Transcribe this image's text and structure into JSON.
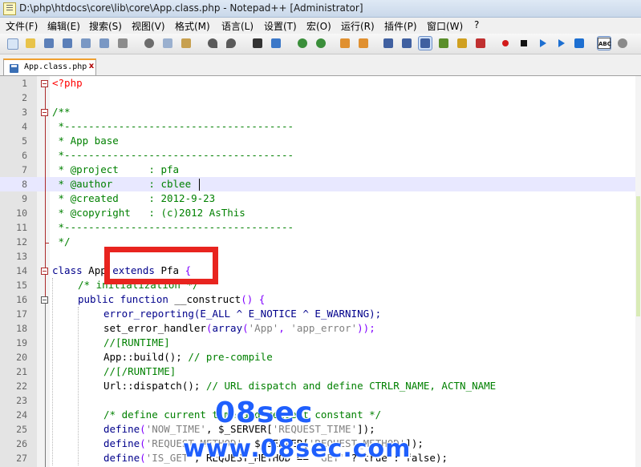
{
  "window": {
    "title": "D:\\php\\htdocs\\core\\lib\\core\\App.class.php - Notepad++ [Administrator]"
  },
  "menu": {
    "items": [
      {
        "label": "文件(F)"
      },
      {
        "label": "编辑(E)"
      },
      {
        "label": "搜索(S)"
      },
      {
        "label": "视图(V)"
      },
      {
        "label": "格式(M)"
      },
      {
        "label": "语言(L)"
      },
      {
        "label": "设置(T)"
      },
      {
        "label": "宏(O)"
      },
      {
        "label": "运行(R)"
      },
      {
        "label": "插件(P)"
      },
      {
        "label": "窗口(W)"
      },
      {
        "label": "?"
      }
    ]
  },
  "toolbar": {
    "buttons": [
      {
        "icon": "new-file-icon",
        "color": "#d8e6f6"
      },
      {
        "icon": "open-file-icon",
        "color": "#e8c34a"
      },
      {
        "icon": "save-icon",
        "color": "#5b7fb8"
      },
      {
        "icon": "save-all-icon",
        "color": "#5b7fb8"
      },
      {
        "icon": "close-icon",
        "color": "#7a98c4"
      },
      {
        "icon": "close-all-icon",
        "color": "#7a98c4"
      },
      {
        "icon": "print-icon",
        "color": "#8c8c8c"
      },
      {
        "icon": "cut-icon",
        "color": "#6c6c6c"
      },
      {
        "icon": "copy-icon",
        "color": "#9ab0cf"
      },
      {
        "icon": "paste-icon",
        "color": "#c7a04f"
      },
      {
        "icon": "undo-icon",
        "color": "#5a5a5a"
      },
      {
        "icon": "redo-icon",
        "color": "#5a5a5a"
      },
      {
        "icon": "find-icon",
        "color": "#333333"
      },
      {
        "icon": "replace-icon",
        "color": "#3c78c8"
      },
      {
        "icon": "zoom-in-icon",
        "color": "#3a8e3a"
      },
      {
        "icon": "zoom-out-icon",
        "color": "#3a8e3a"
      },
      {
        "icon": "sync-vertical-icon",
        "color": "#e09030"
      },
      {
        "icon": "sync-horizontal-icon",
        "color": "#e09030"
      },
      {
        "icon": "word-wrap-icon",
        "color": "#4060a0"
      },
      {
        "icon": "show-all-chars-icon",
        "color": "#4060a0"
      },
      {
        "icon": "indent-guide-icon",
        "color": "#4060a0"
      },
      {
        "icon": "udl-icon",
        "color": "#5a8e2a"
      },
      {
        "icon": "doc-map-icon",
        "color": "#d0a020"
      },
      {
        "icon": "function-list-icon",
        "color": "#c03030"
      },
      {
        "icon": "record-macro-icon",
        "color": "#d21a1a"
      },
      {
        "icon": "stop-record-icon",
        "color": "#111111"
      },
      {
        "icon": "play-macro-icon",
        "color": "#1d6fd1"
      },
      {
        "icon": "play-multiple-icon",
        "color": "#1d6fd1"
      },
      {
        "icon": "save-macro-icon",
        "color": "#1d6fd1"
      },
      {
        "icon": "spell-check-icon",
        "color": "#ffffff"
      },
      {
        "icon": "plugin-icon",
        "color": "#8a8a8a"
      }
    ]
  },
  "tab": {
    "label": "App.class.php",
    "close": "x"
  },
  "editor": {
    "lines": [
      {
        "n": "1"
      },
      {
        "n": "2"
      },
      {
        "n": "3"
      },
      {
        "n": "4"
      },
      {
        "n": "5"
      },
      {
        "n": "6"
      },
      {
        "n": "7"
      },
      {
        "n": "8"
      },
      {
        "n": "9"
      },
      {
        "n": "10"
      },
      {
        "n": "11"
      },
      {
        "n": "12"
      },
      {
        "n": "13"
      },
      {
        "n": "14"
      },
      {
        "n": "15"
      },
      {
        "n": "16"
      },
      {
        "n": "17"
      },
      {
        "n": "18"
      },
      {
        "n": "19"
      },
      {
        "n": "20"
      },
      {
        "n": "21"
      },
      {
        "n": "22"
      },
      {
        "n": "23"
      },
      {
        "n": "24"
      },
      {
        "n": "25"
      },
      {
        "n": "26"
      },
      {
        "n": "27"
      }
    ],
    "code": {
      "l1": "<?php",
      "l3": "/**",
      "l4": " *--------------------------------------",
      "l5": " * App base",
      "l6": " *--------------------------------------",
      "l7": " * @project     : pfa",
      "l8": " * @author      : cblee",
      "l9": " * @created     : 2012-9-23",
      "l10": " * @copyright   : (c)2012 AsThis",
      "l11": " *--------------------------------------",
      "l12": " */",
      "l14_kw": "class",
      "l14_name": " App ",
      "l14_kw2": "extends",
      "l14_parent": " Pfa ",
      "l14_brace": "{",
      "l15": "/* initialization */",
      "l16_kw": "public function",
      "l16_name": " __construct",
      "l16_rest": "() {",
      "l17_fn": "error_reporting",
      "l17_rest": "(E_ALL ^ E_NOTICE ^ E_WARNING);",
      "l18_fn": "set_error_handler",
      "l18_a": "(",
      "l18_kw": "array",
      "l18_b": "(",
      "l18_s1": "'App'",
      "l18_c": ", ",
      "l18_s2": "'app_error'",
      "l18_d": "));",
      "l19": "//[RUNTIME]",
      "l20_a": "App::build(); ",
      "l20_cmt": "// pre-compile",
      "l21": "//[/RUNTIME]",
      "l22_a": "Url::dispatch(); ",
      "l22_cmt": "// URL dispatch and define CTRLR_NAME, ACTN_NAME",
      "l24": "/* define current time and request constant */",
      "l25_fn": "define",
      "l25_a": "(",
      "l25_s1": "'NOW_TIME'",
      "l25_b": ", $_SERVER[",
      "l25_s2": "'REQUEST_TIME'",
      "l25_c": "]);",
      "l26_fn": "define",
      "l26_a": "(",
      "l26_s1": "'REQUEST_METHOD'",
      "l26_b": ", $_SERVER[",
      "l26_s2": "'REQUEST_METHOD'",
      "l26_c": "]);",
      "l27_fn": "define",
      "l27_a": "(",
      "l27_s1": "'IS_GET'",
      "l27_b": ", REQUEST_METHOD == ",
      "l27_s2": "'GET'",
      "l27_c": " ? true : false);"
    }
  },
  "watermark": {
    "line1": "08sec",
    "line2": "www.08sec.com"
  }
}
